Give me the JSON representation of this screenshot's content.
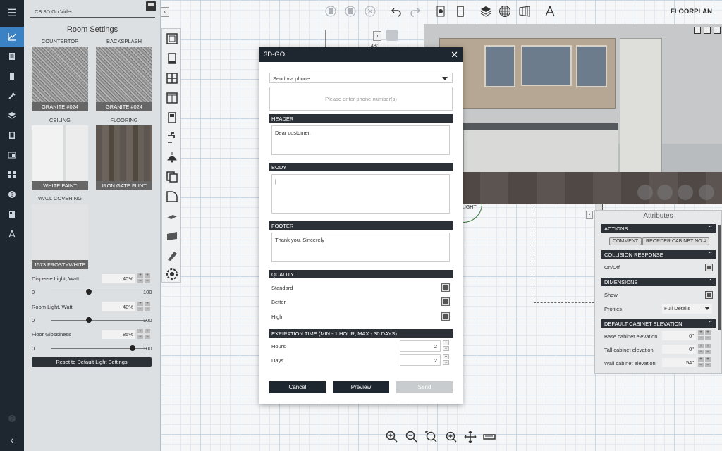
{
  "project": {
    "name": "CB 3D Go Video"
  },
  "room_settings": {
    "title": "Room Settings",
    "materials": [
      {
        "category": "COUNTERTOP",
        "name": "GRANITE #024"
      },
      {
        "category": "BACKSPLASH",
        "name": "GRANITE #024"
      },
      {
        "category": "CEILING",
        "name": "WHITE PAINT"
      },
      {
        "category": "FLOORING",
        "name": "IRON GATE FLINT"
      },
      {
        "category": "WALL COVERING",
        "name": "1573 FROSTYWHITE"
      }
    ],
    "sliders": [
      {
        "label": "Disperse Light, Watt",
        "value": "40%",
        "min": "0",
        "max": "100",
        "fraction": 0.4
      },
      {
        "label": "Room Light, Watt",
        "value": "40%",
        "min": "0",
        "max": "100",
        "fraction": 0.4
      },
      {
        "label": "Floor Glossiness",
        "value": "85%",
        "min": "0",
        "max": "100",
        "fraction": 0.85
      }
    ],
    "reset_label": "Reset to Default Light Settings"
  },
  "toolbar": {
    "view_mode": "FLOORPLAN"
  },
  "floorplan": {
    "dim_label": "48\"",
    "light_label": "LIGHT"
  },
  "modal": {
    "title": "3D-GO",
    "send_method": "Send via phone",
    "phone_placeholder": "Please enter phone-number(s)",
    "header_label": "HEADER",
    "header_text": "Dear customer,",
    "body_label": "BODY",
    "body_text": "|",
    "footer_label": "FOOTER",
    "footer_text": "Thank you, Sincerely",
    "quality_label": "QUALITY",
    "quality_options": [
      "Standard",
      "Better",
      "High"
    ],
    "expiration_label": "EXPIRATION TIME (MIN - 1 HOUR, MAX - 30 DAYS)",
    "hours_label": "Hours",
    "hours_value": "2",
    "days_label": "Days",
    "days_value": "2",
    "cancel_label": "Cancel",
    "preview_label": "Preview",
    "send_label": "Send"
  },
  "attributes": {
    "title": "Attributes",
    "actions_label": "ACTIONS",
    "comment_label": "COMMENT",
    "reorder_label": "REORDER CABINET NO.#",
    "collision_label": "COLLISION RESPONSE",
    "onoff_label": "On/Off",
    "dimensions_label": "DIMENSIONS",
    "show_label": "Show",
    "profiles_label": "Profiles",
    "profiles_value": "Full Details",
    "elevation_label": "DEFAULT CABINET ELEVATION",
    "elevations": [
      {
        "label": "Base cabinet elevation",
        "value": "0\""
      },
      {
        "label": "Tall cabinet elevation",
        "value": "0\""
      },
      {
        "label": "Wall cabinet elevation",
        "value": "54\""
      }
    ]
  },
  "colors": {
    "rail": "#1e2630",
    "active": "#3b82c4",
    "section": "#2b3137"
  }
}
